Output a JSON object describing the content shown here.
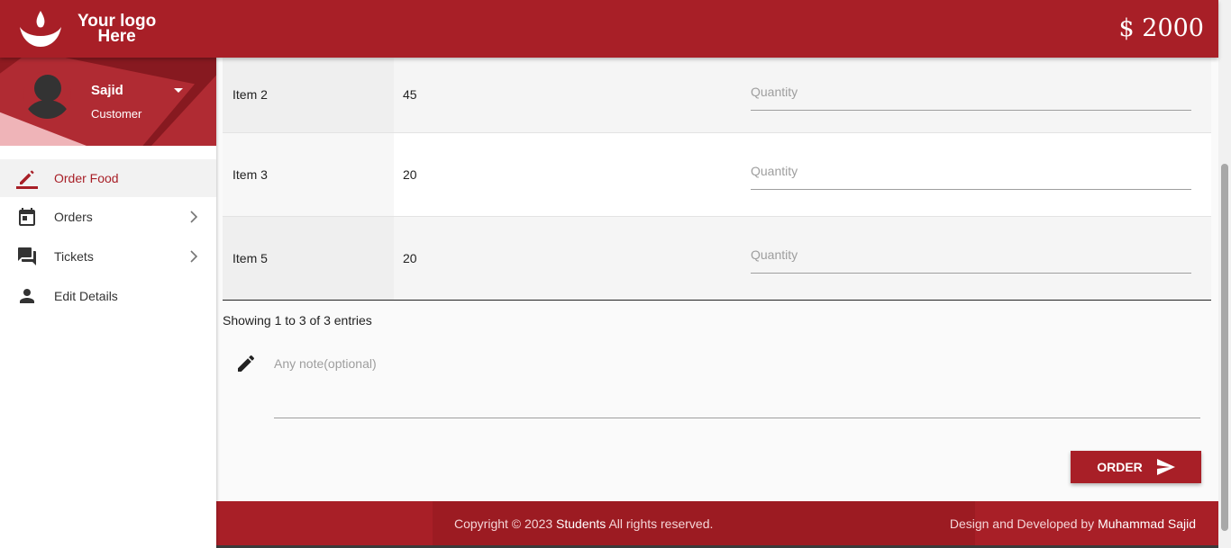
{
  "header": {
    "logo_line1": "Your logo",
    "logo_line2": "Here",
    "balance": "$ 2000"
  },
  "profile": {
    "name": "Sajid",
    "role": "Customer"
  },
  "nav": [
    {
      "label": "Order Food",
      "icon": "pencil-icon",
      "active": true
    },
    {
      "label": "Orders",
      "icon": "calendar-icon",
      "has_chevron": true
    },
    {
      "label": "Tickets",
      "icon": "forum-icon",
      "has_chevron": true
    },
    {
      "label": "Edit Details",
      "icon": "person-icon"
    }
  ],
  "items": [
    {
      "name": "Item 2",
      "price": "45",
      "qty_placeholder": "Quantity"
    },
    {
      "name": "Item 3",
      "price": "20",
      "qty_placeholder": "Quantity"
    },
    {
      "name": "Item 5",
      "price": "20",
      "qty_placeholder": "Quantity"
    }
  ],
  "table_info": "Showing 1 to 3 of 3 entries",
  "note": {
    "placeholder": "Any note(optional)"
  },
  "order_button": "ORDER",
  "footer": {
    "copy_prefix": "Copyright © 2023",
    "copy_brand": "Students",
    "copy_suffix": "All rights reserved.",
    "dev_prefix": "Design and Developed by",
    "dev_name": "Muhammad Sajid"
  },
  "colors": {
    "accent": "#a81f27"
  }
}
